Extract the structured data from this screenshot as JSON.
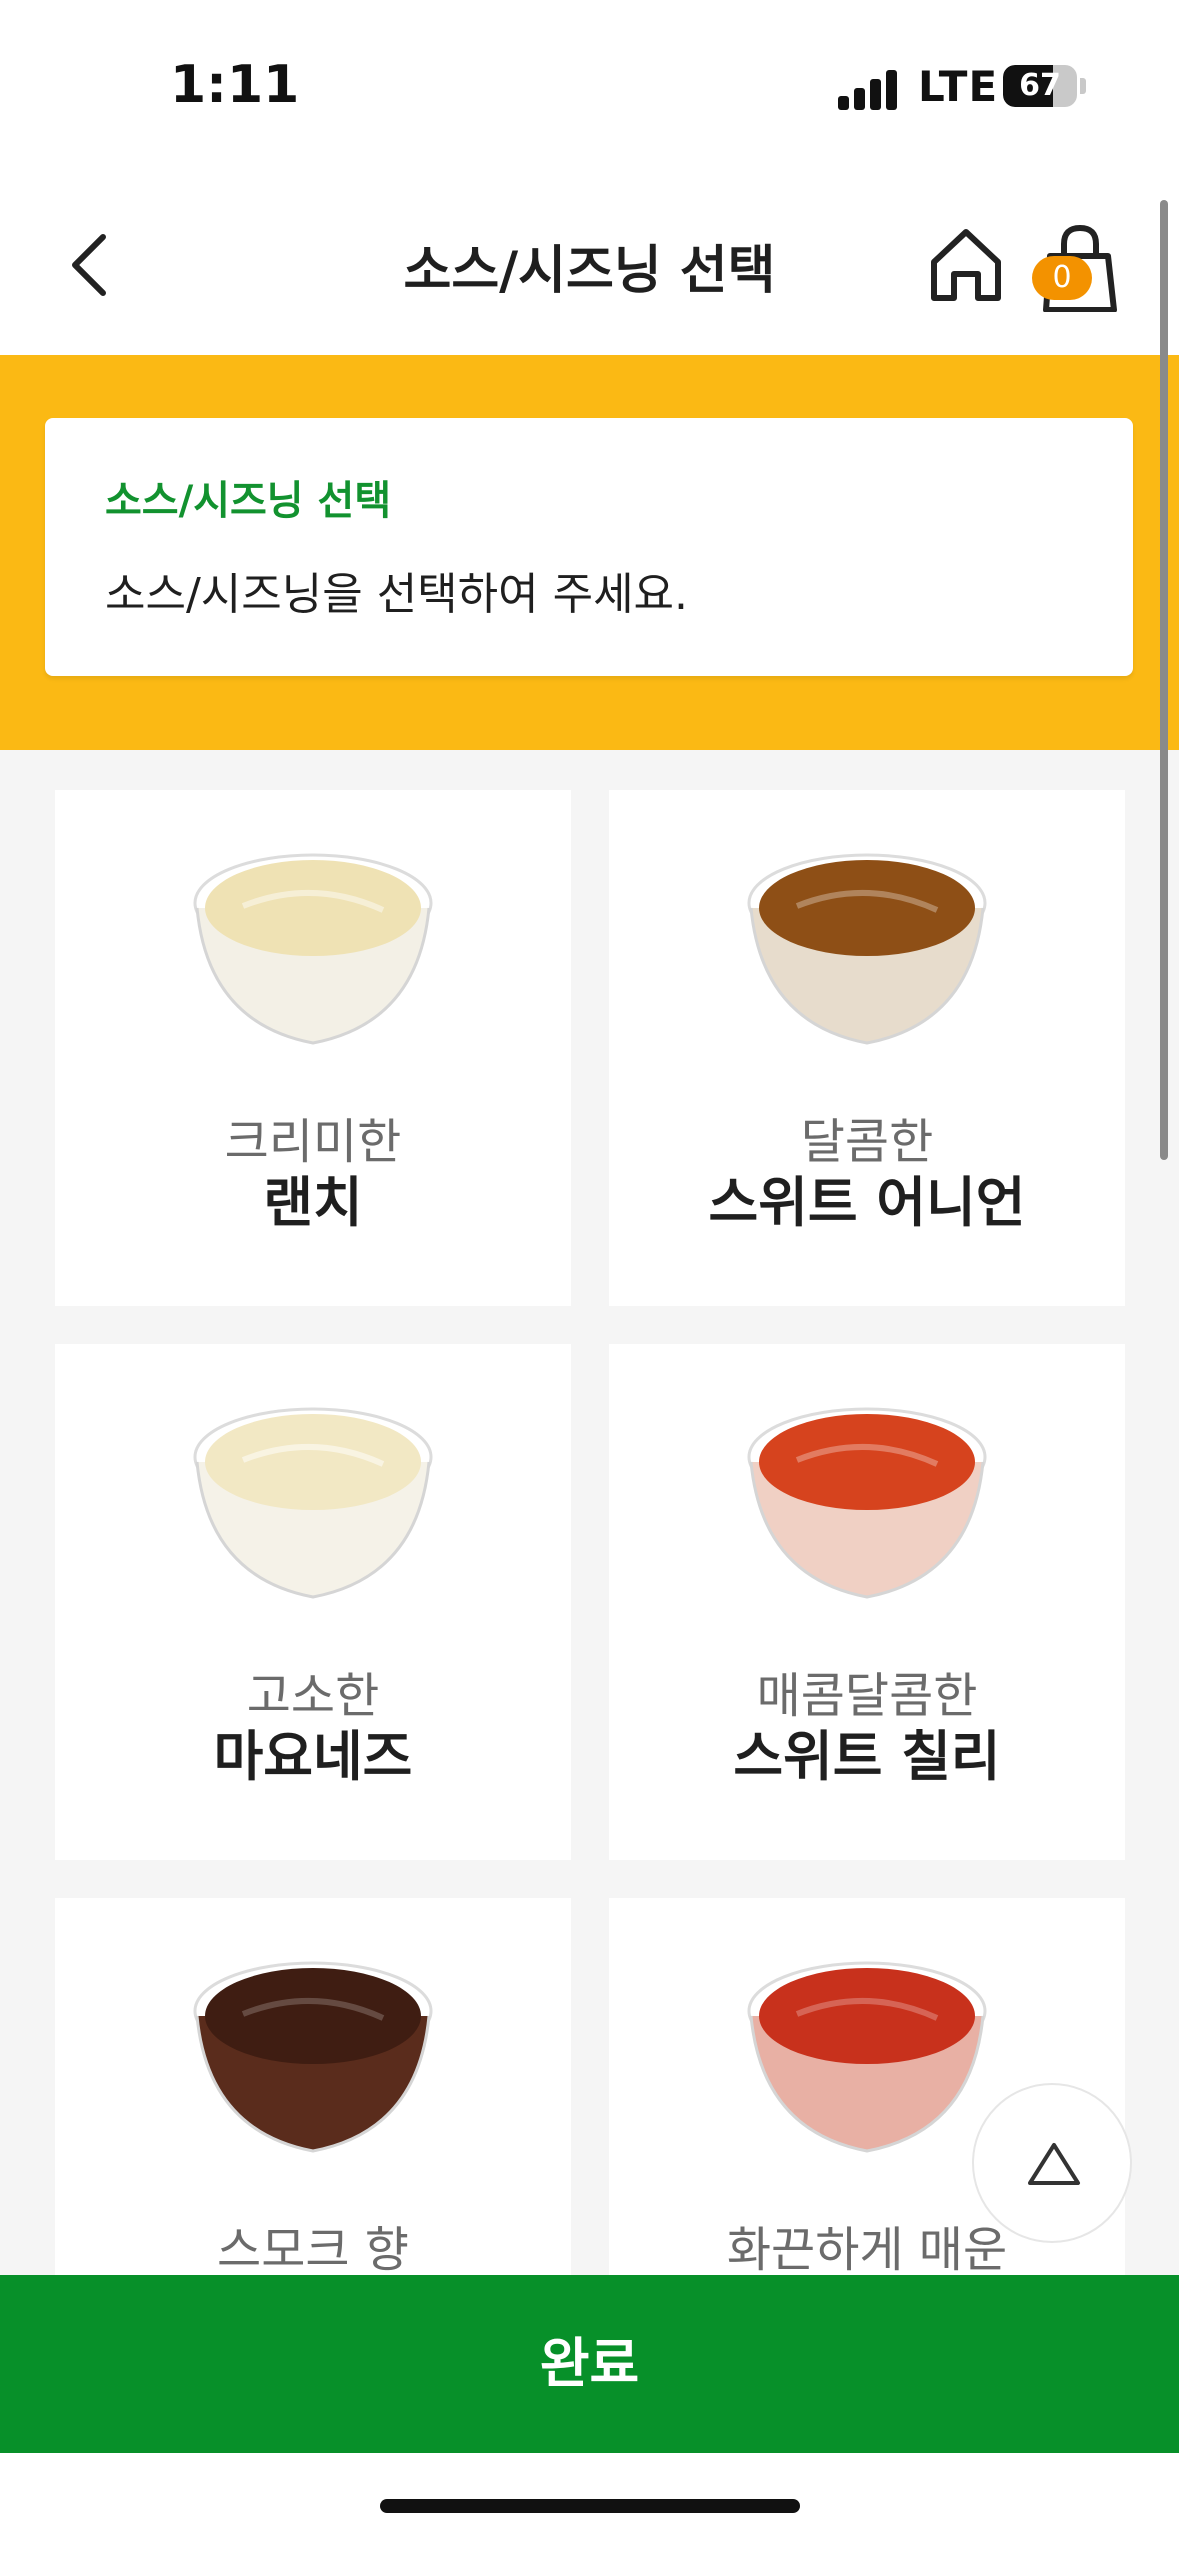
{
  "status_bar": {
    "time": "1:11",
    "network": "LTE",
    "battery": "67",
    "battery_level": 0.67
  },
  "header": {
    "title": "소스/시즈닝 선택",
    "cart_count": "0"
  },
  "banner": {
    "title": "소스/시즈닝 선택",
    "description": "소스/시즈닝을 선택하여 주세요."
  },
  "sauces": [
    {
      "sub": "크리미한",
      "name": "랜치",
      "color": "#efe2b4"
    },
    {
      "sub": "달콤한",
      "name": "스위트 어니언",
      "color": "#8e4f16"
    },
    {
      "sub": "고소한",
      "name": "마요네즈",
      "color": "#f2e8c4"
    },
    {
      "sub": "매콤달콤한",
      "name": "스위트 칠리",
      "color": "#d6431e"
    },
    {
      "sub": "스모크 향",
      "name": "",
      "color": "#3f1d12"
    },
    {
      "sub": "화끈하게 매운",
      "name": "",
      "color": "#c8311c"
    }
  ],
  "actions": {
    "complete": "완료"
  },
  "colors": {
    "banner_bg": "#fbb914",
    "brand_green": "#079029",
    "badge_orange": "#f39200"
  }
}
